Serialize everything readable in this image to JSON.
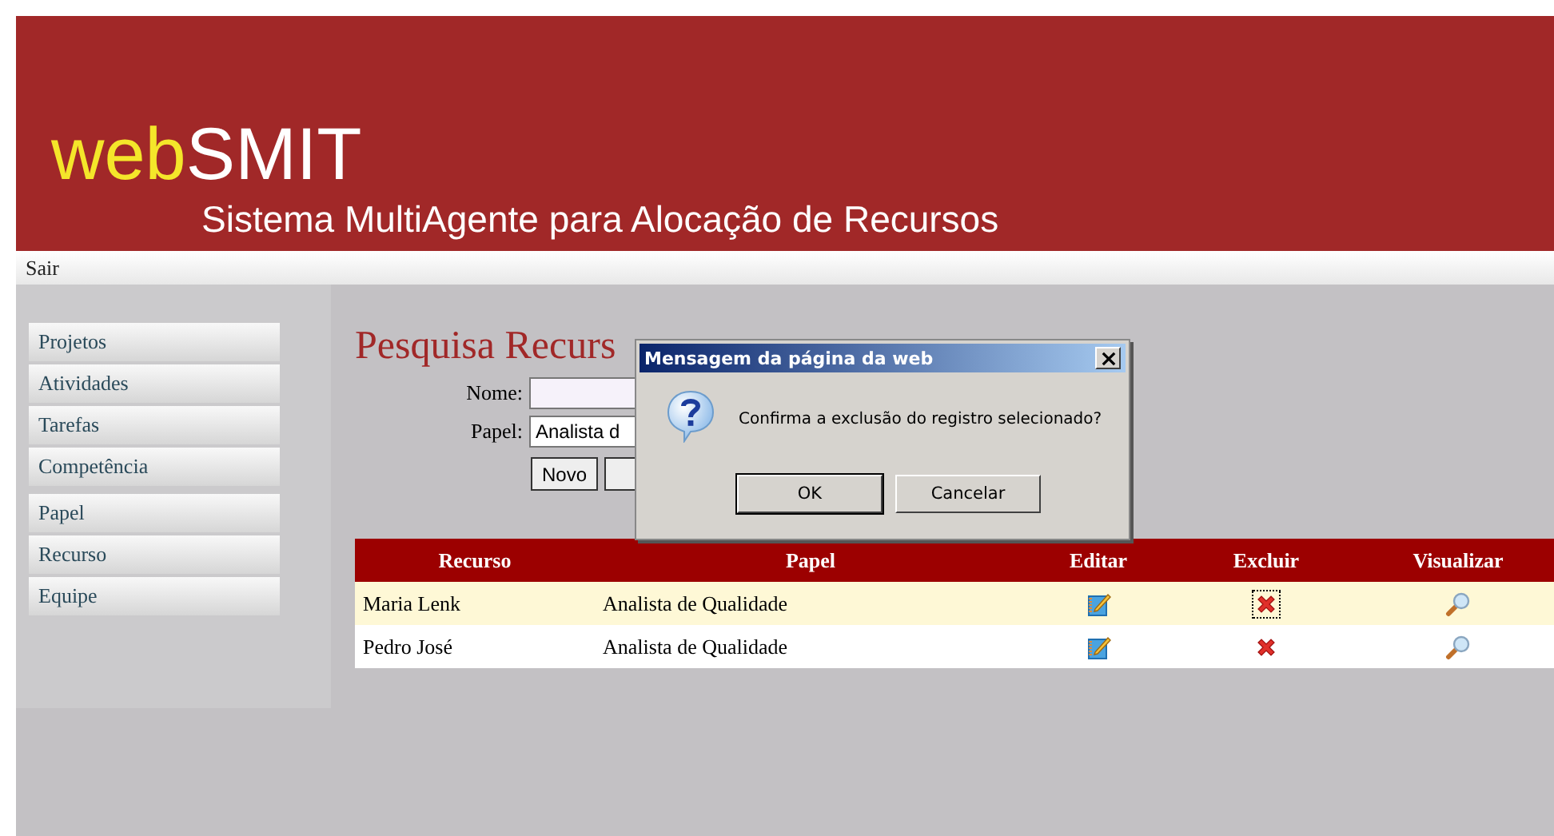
{
  "header": {
    "logo_prefix": "web",
    "logo_suffix": "SMIT",
    "subtitle": "Sistema MultiAgente para Alocação de Recursos"
  },
  "nav": {
    "link": "Sair"
  },
  "sidebar": {
    "items": [
      {
        "label": "Projetos"
      },
      {
        "label": "Atividades"
      },
      {
        "label": "Tarefas"
      },
      {
        "label": "Competência"
      },
      {
        "label": "Papel"
      },
      {
        "label": "Recurso"
      },
      {
        "label": "Equipe"
      }
    ]
  },
  "search": {
    "title": "Pesquisa Recurs",
    "name_label": "Nome:",
    "role_label": "Papel:",
    "role_value": "Analista d",
    "buttons": [
      "Novo"
    ]
  },
  "table": {
    "columns": [
      "Recurso",
      "Papel",
      "Editar",
      "Excluir",
      "Visualizar"
    ],
    "rows": [
      {
        "recurso": "Maria Lenk",
        "papel": "Analista de Qualidade",
        "selected": true
      },
      {
        "recurso": "Pedro José",
        "papel": "Analista de Qualidade",
        "selected": false
      }
    ]
  },
  "dialog": {
    "title": "Mensagem da página da web",
    "message": "Confirma a exclusão do registro selecionado?",
    "buttons": [
      {
        "label": "OK",
        "selected": true
      },
      {
        "label": "Cancelar",
        "selected": false
      }
    ]
  }
}
